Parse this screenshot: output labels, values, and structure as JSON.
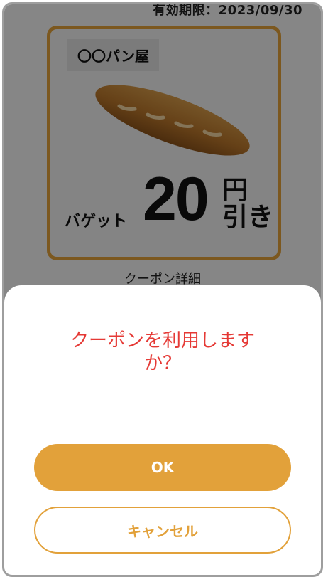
{
  "coupon": {
    "expiry_text": "有効期限：2023/09/30",
    "shop_name": "〇〇パン屋",
    "item_name": "バゲット",
    "discount_amount": "20",
    "discount_unit_line1": "円",
    "discount_unit_line2": "引き",
    "detail_label": "クーポン詳細",
    "icon": "baguette-image"
  },
  "dialog": {
    "question": "クーポンを利用しますか？",
    "ok_label": "OK",
    "cancel_label": "キャンセル"
  },
  "colors": {
    "accent": "#e2a13a",
    "question_text": "#e53935",
    "overlay": "rgba(0,0,0,0.45)"
  }
}
